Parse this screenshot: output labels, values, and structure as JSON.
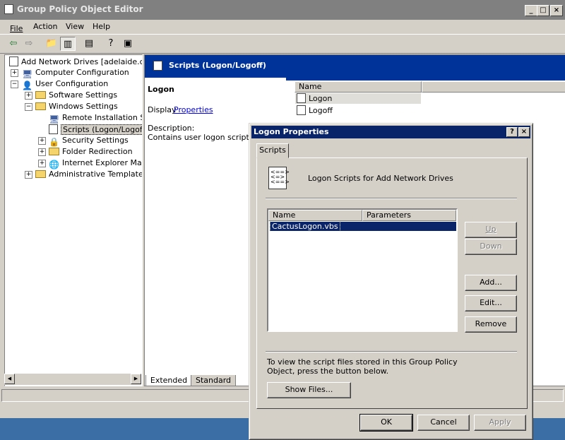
{
  "window": {
    "title": "Group Policy Object Editor"
  },
  "menu": [
    {
      "label": "File"
    },
    {
      "label": "Action"
    },
    {
      "label": "View"
    },
    {
      "label": "Help"
    }
  ],
  "tree": {
    "root": "Add Network Drives [adelaide.cactus]",
    "computer": "Computer Configuration",
    "user": "User Configuration",
    "software": "Software Settings",
    "windows": "Windows Settings",
    "remote": "Remote Installation Services",
    "scripts": "Scripts (Logon/Logoff)",
    "security": "Security Settings",
    "folder": "Folder Redirection",
    "ie": "Internet Explorer Maintenance",
    "admin": "Administrative Templates"
  },
  "details": {
    "banner": "Scripts (Logon/Logoff)",
    "heading": "Logon",
    "display_prefix": "Display",
    "display_link": "Properties",
    "description_label": "Description:",
    "description_text": "Contains user logon scripts.",
    "column_name": "Name",
    "items": [
      {
        "name": "Logon"
      },
      {
        "name": "Logoff"
      }
    ]
  },
  "view_tabs": [
    {
      "label": "Extended"
    },
    {
      "label": "Standard"
    }
  ],
  "dialog": {
    "title": "Logon Properties",
    "tab": "Scripts",
    "header_text": "Logon Scripts for Add Network Drives",
    "col_name": "Name",
    "col_params": "Parameters",
    "scripts": [
      {
        "name": "CactusLogon.vbs",
        "params": ""
      }
    ],
    "buttons": {
      "up": "Up",
      "down": "Down",
      "add": "Add...",
      "edit": "Edit...",
      "remove": "Remove",
      "show_files": "Show Files...",
      "ok": "OK",
      "cancel": "Cancel",
      "apply": "Apply"
    },
    "info_text": "To view the script files stored in this Group Policy Object, press the button below."
  }
}
